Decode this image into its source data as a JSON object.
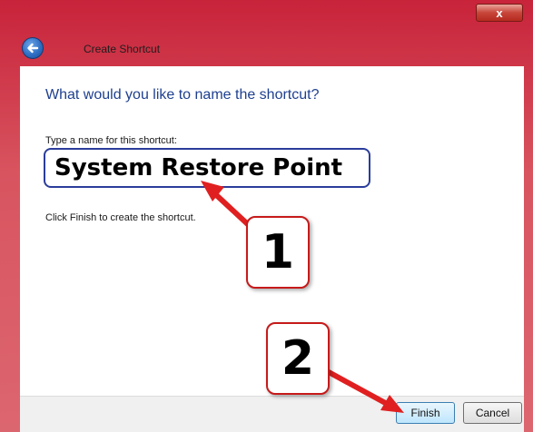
{
  "window": {
    "title": "Create Shortcut",
    "close_glyph": "x",
    "accent_color": "#c8233a"
  },
  "wizard": {
    "heading": "What would you like to name the shortcut?",
    "field_label": "Type a name for this shortcut:",
    "shortcut_name": "System Restore Point",
    "hint": "Click Finish to create the shortcut."
  },
  "buttons": {
    "finish": "Finish",
    "cancel": "Cancel"
  },
  "annotations": {
    "callout_1": "1",
    "callout_2": "2",
    "arrow_color": "#e02020"
  },
  "icons": {
    "back": "back-arrow-icon",
    "close": "close-icon"
  }
}
